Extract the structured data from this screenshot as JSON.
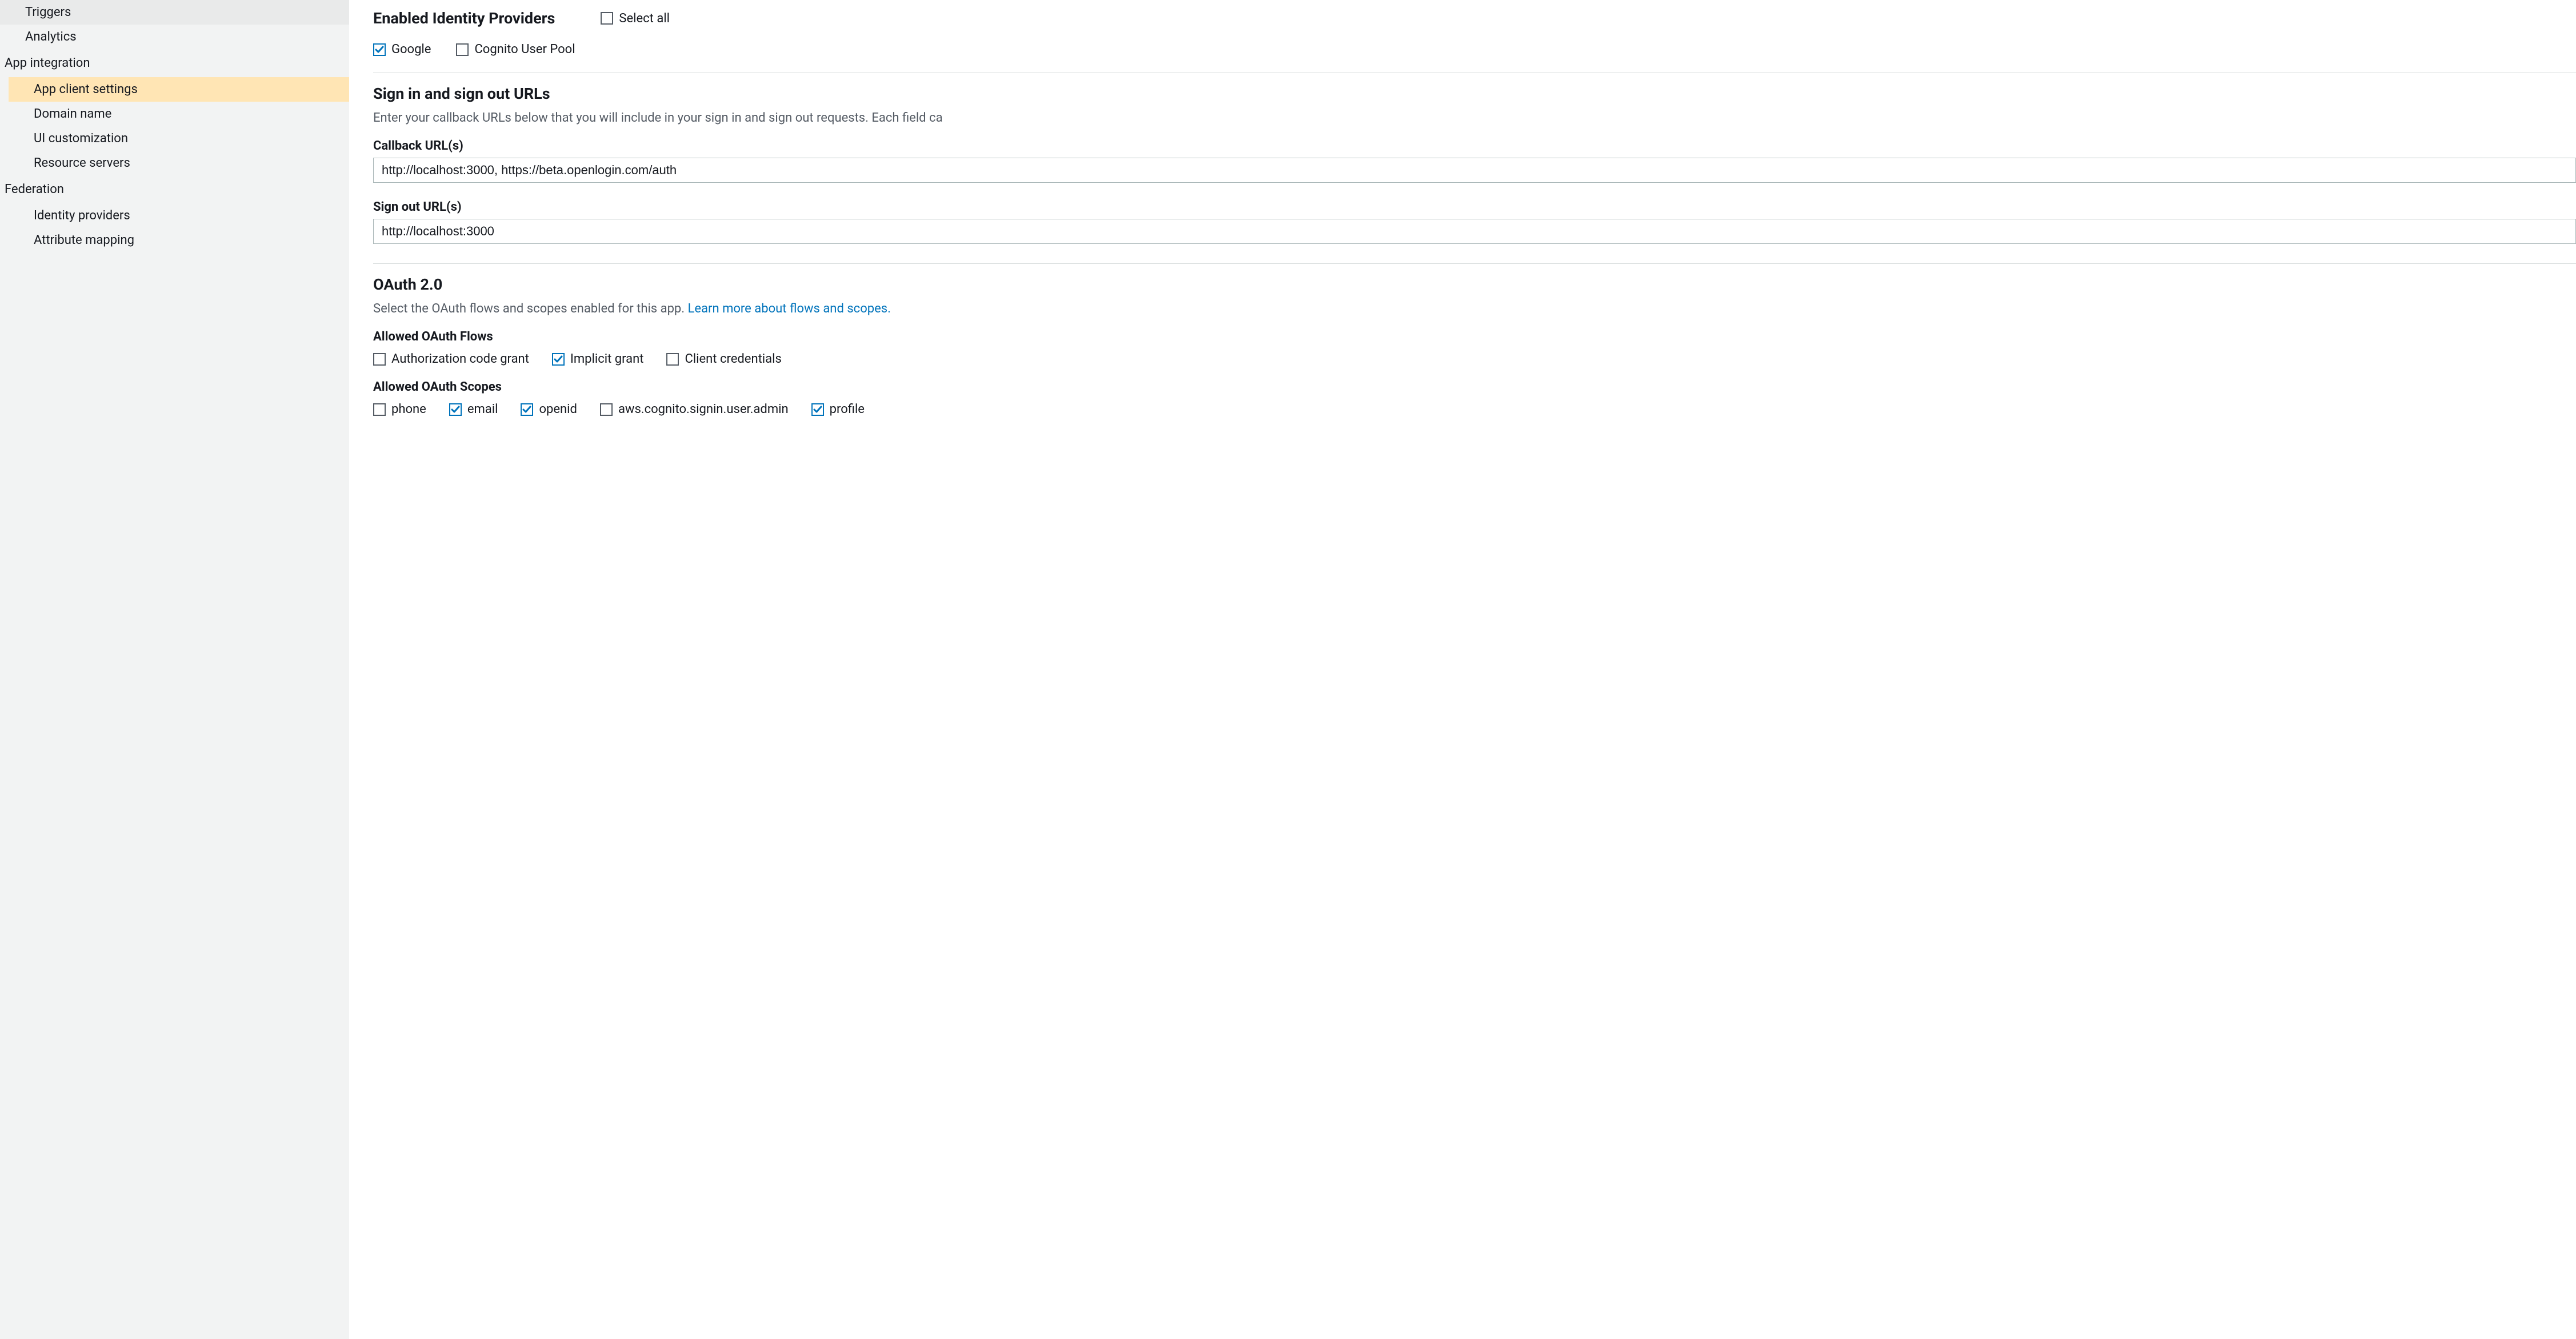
{
  "colors": {
    "accent": "#0073bb",
    "sidebarBg": "#f2f3f3",
    "active": "#ffe5b4",
    "link": "#0073bb"
  },
  "sidebar": {
    "groups": [
      {
        "id": "general",
        "title": null,
        "items": [
          {
            "id": "triggers",
            "label": "Triggers",
            "active": false
          },
          {
            "id": "analytics",
            "label": "Analytics",
            "active": false
          }
        ]
      },
      {
        "id": "app-integration",
        "title": "App integration",
        "items": [
          {
            "id": "app-client-settings",
            "label": "App client settings",
            "active": true
          },
          {
            "id": "domain-name",
            "label": "Domain name",
            "active": false
          },
          {
            "id": "ui-customization",
            "label": "UI customization",
            "active": false
          },
          {
            "id": "resource-servers",
            "label": "Resource servers",
            "active": false
          }
        ]
      },
      {
        "id": "federation",
        "title": "Federation",
        "items": [
          {
            "id": "identity-providers",
            "label": "Identity providers",
            "active": false
          },
          {
            "id": "attribute-mapping",
            "label": "Attribute mapping",
            "active": false
          }
        ]
      }
    ]
  },
  "main": {
    "idp": {
      "heading": "Enabled Identity Providers",
      "selectAll": {
        "label": "Select all",
        "checked": false
      },
      "providers": [
        {
          "id": "google",
          "label": "Google",
          "checked": true
        },
        {
          "id": "cognito",
          "label": "Cognito User Pool",
          "checked": false
        }
      ]
    },
    "urls": {
      "heading": "Sign in and sign out URLs",
      "description": "Enter your callback URLs below that you will include in your sign in and sign out requests. Each field ca",
      "callback": {
        "label": "Callback URL(s)",
        "value": "http://localhost:3000, https://beta.openlogin.com/auth"
      },
      "signout": {
        "label": "Sign out URL(s)",
        "value": "http://localhost:3000"
      }
    },
    "oauth": {
      "heading": "OAuth 2.0",
      "description": "Select the OAuth flows and scopes enabled for this app. ",
      "learnMore": "Learn more about flows and scopes.",
      "flows": {
        "label": "Allowed OAuth Flows",
        "items": [
          {
            "id": "auth-code",
            "label": "Authorization code grant",
            "checked": false
          },
          {
            "id": "implicit",
            "label": "Implicit grant",
            "checked": true
          },
          {
            "id": "client",
            "label": "Client credentials",
            "checked": false
          }
        ]
      },
      "scopes": {
        "label": "Allowed OAuth Scopes",
        "items": [
          {
            "id": "phone",
            "label": "phone",
            "checked": false
          },
          {
            "id": "email",
            "label": "email",
            "checked": true
          },
          {
            "id": "openid",
            "label": "openid",
            "checked": true
          },
          {
            "id": "admin",
            "label": "aws.cognito.signin.user.admin",
            "checked": false
          },
          {
            "id": "profile",
            "label": "profile",
            "checked": true
          }
        ]
      }
    }
  }
}
